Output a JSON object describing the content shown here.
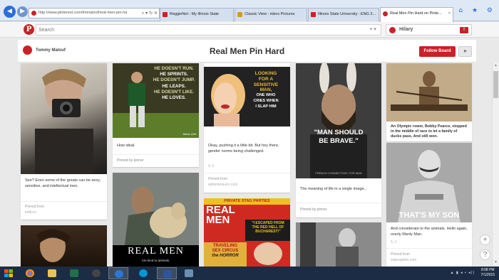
{
  "browser": {
    "address": "http://www.pinterest.com/tmmalouf/real-men-pin-ha",
    "tabs": [
      {
        "label": "ReggieNet : My Illinois State",
        "color": "#cc2222"
      },
      {
        "label": "Classic View : mbox Pictures",
        "color": "#d89a1a"
      },
      {
        "label": "Illinois State University : ENG 2...",
        "color": "#cc2222"
      },
      {
        "label": "Real Men Pin Hard on Pinte...",
        "color": "#cb2027"
      }
    ],
    "right_icons": "⌂ ★ ⚙"
  },
  "header": {
    "logo": "P",
    "search_placeholder": "Search",
    "menu_icon": "≡ ▾",
    "user_name": "Hilary",
    "notif": "!"
  },
  "board": {
    "owner": "Tommy Malouf",
    "title": "Real Men Pin Hard",
    "follow_label": "Follow Board",
    "send_icon": "➤"
  },
  "pins": [
    {
      "desc": "See? Even some of the greats can be sexy, sensitive, and intellectual men.",
      "src_label": "Pinned from",
      "src": "tmflu.in"
    },
    {
      "overlay": [
        "HE DOESN'T RUN.",
        "HE SPRINTS.",
        "HE DOESN'T JUMP.",
        "HE LEAPS.",
        "HE DOESN'T LIKE.",
        "HE LOVES."
      ],
      "corner": "Mens Golf",
      "desc": "How ideal.",
      "by": "Pinned by pinner"
    },
    {
      "overlay": [
        "REAL MEN"
      ],
      "caption": "Are kind to animals."
    },
    {
      "overlay": [
        "LOOKING",
        "FOR A",
        "SENSITIVE",
        "MAN,",
        "ONE WHO",
        "CRIES WHEN",
        "I SLAP HIM"
      ],
      "desc": "Okay, pushing it a little bit. But hey there, gender norms being challenged.",
      "rep": "2",
      "src_label": "Pinned from",
      "src": "ephemera-inc.com"
    },
    {
      "overlay": [
        "PRIVATE STAG PARTIES",
        "REAL",
        "MEN",
        "TRAVELING",
        "SEX CIRCUS",
        "\"I ESCAPED FROM",
        "THE RED HELL OF",
        "BUCHAREST!\"",
        "the HORROR"
      ]
    },
    {
      "overlay": [
        "\"MAN SHOULD",
        "BE BRAVE.\""
      ],
      "footer": "FRENCH CONNECTION. FOR MAN",
      "desc": "The meaning of life in a single image...",
      "by": "Pinned by pinner"
    },
    {
      "desc": "An Olympic rower, Bobby Pearce, stopped in the middle of race to let a family of ducks pass. And still won."
    },
    {
      "overlay": [
        "THAT'S MY SON"
      ],
      "desc": "And considerate to the animals. Hello again, overly Manly Man.",
      "rep": "1",
      "src_label": "Pinned from",
      "src": "slapcaption.com"
    }
  ],
  "side": {
    "add": "+",
    "help": "?"
  },
  "taskbar": {
    "time": "8:08 PM",
    "date": "7/1/2015",
    "tray": "▲ ▮ ◂ ▪ ◂))"
  }
}
